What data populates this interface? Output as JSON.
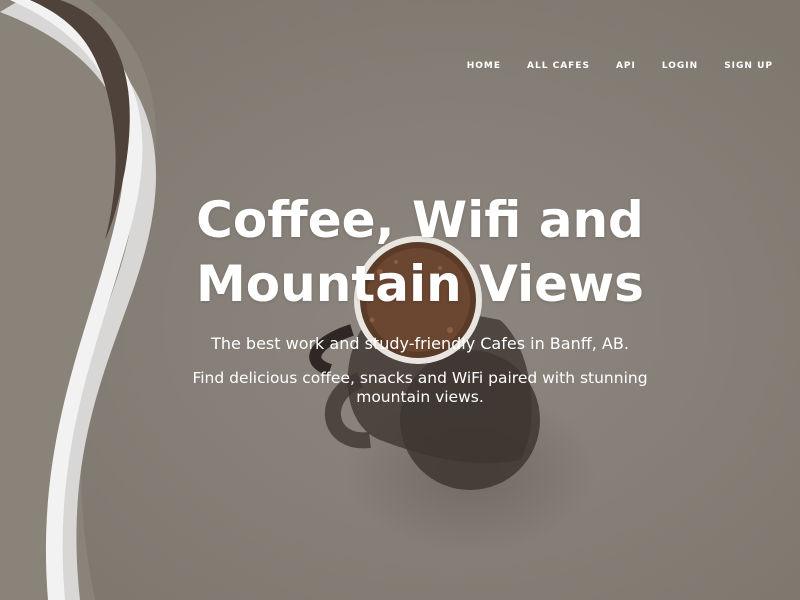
{
  "nav": {
    "items": [
      {
        "label": "HOME"
      },
      {
        "label": "ALL CAFES"
      },
      {
        "label": "API"
      },
      {
        "label": "LOGIN"
      },
      {
        "label": "SIGN UP"
      }
    ]
  },
  "hero": {
    "title_line1": "Coffee, Wifi and",
    "title_line2": "Mountain Views",
    "subtitle": "The best work and study-friendly Cafes in Banff, AB.",
    "description": "Find delicious coffee, snacks and WiFi paired with stunning mountain views."
  },
  "colors": {
    "background": "#8a837a",
    "text": "#ffffff",
    "swoosh_dark": "#5b4d45",
    "swoosh_light": "#eeeeee"
  }
}
